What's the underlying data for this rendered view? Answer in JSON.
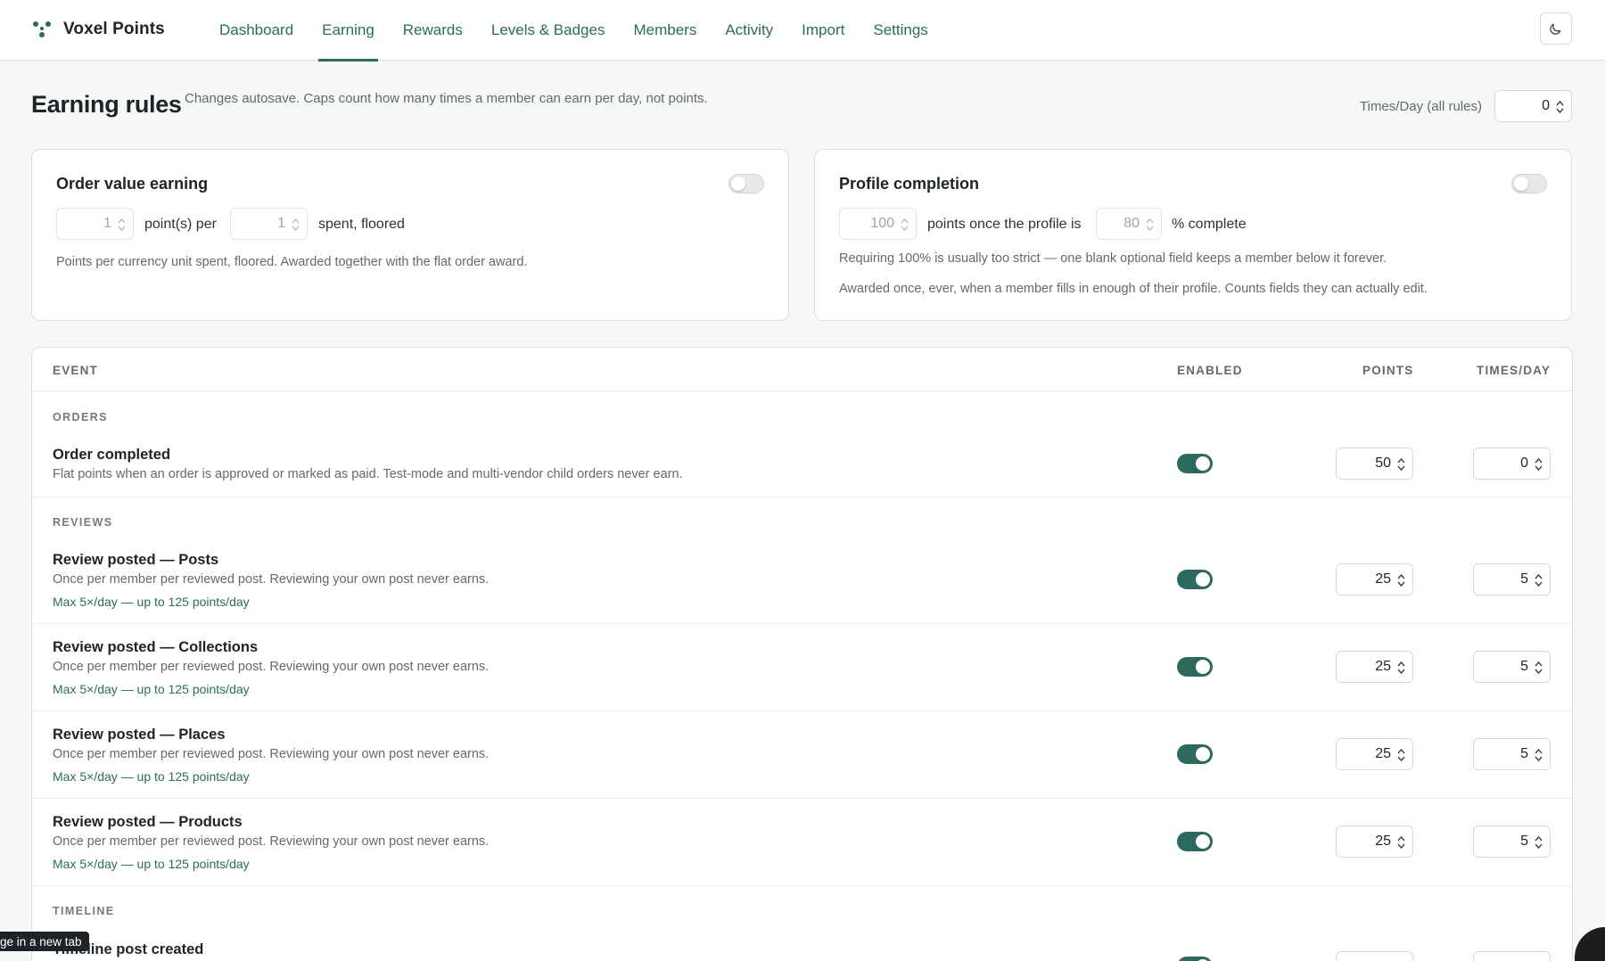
{
  "app": {
    "name": "Voxel Points",
    "logo_icon": "molecule-logo-icon",
    "accent_color": "#2d6a5d"
  },
  "nav": {
    "items": [
      {
        "label": "Dashboard",
        "active": false
      },
      {
        "label": "Earning",
        "active": true
      },
      {
        "label": "Rewards",
        "active": false
      },
      {
        "label": "Levels & Badges",
        "active": false
      },
      {
        "label": "Members",
        "active": false
      },
      {
        "label": "Activity",
        "active": false
      },
      {
        "label": "Import",
        "active": false
      },
      {
        "label": "Settings",
        "active": false
      }
    ],
    "theme_toggle_icon": "moon-icon"
  },
  "header": {
    "title": "Earning rules",
    "description": "Changes autosave. Caps count how many times a member can earn per day, not points.",
    "global_cap_label": "Times/Day (all rules)",
    "global_cap_value": "0"
  },
  "order_value_card": {
    "title": "Order value earning",
    "enabled": false,
    "points_value": "1",
    "points_label": "point(s) per",
    "spent_value": "1",
    "spent_label": "spent, floored",
    "help": "Points per currency unit spent, floored. Awarded together with the flat order award."
  },
  "profile_card": {
    "title": "Profile completion",
    "enabled": false,
    "points_value": "100",
    "points_label": "points once the profile is",
    "percent_value": "80",
    "percent_label": "% complete",
    "help_1": "Requiring 100% is usually too strict — one blank optional field keeps a member below it forever.",
    "help_2": "Awarded once, ever, when a member fills in enough of their profile. Counts fields they can actually edit."
  },
  "table": {
    "headers": {
      "event": "EVENT",
      "enabled": "ENABLED",
      "points": "POINTS",
      "times_day": "TIMES/DAY"
    },
    "groups": [
      {
        "label": "ORDERS",
        "rows": [
          {
            "title": "Order completed",
            "desc": "Flat points when an order is approved or marked as paid. Test-mode and multi-vendor child orders never earn.",
            "cap": "",
            "enabled": true,
            "points": "50",
            "times_day": "0"
          }
        ]
      },
      {
        "label": "REVIEWS",
        "rows": [
          {
            "title": "Review posted — Posts",
            "desc": "Once per member per reviewed post. Reviewing your own post never earns.",
            "cap": "Max 5×/day — up to 125 points/day",
            "enabled": true,
            "points": "25",
            "times_day": "5"
          },
          {
            "title": "Review posted — Collections",
            "desc": "Once per member per reviewed post. Reviewing your own post never earns.",
            "cap": "Max 5×/day — up to 125 points/day",
            "enabled": true,
            "points": "25",
            "times_day": "5"
          },
          {
            "title": "Review posted — Places",
            "desc": "Once per member per reviewed post. Reviewing your own post never earns.",
            "cap": "Max 5×/day — up to 125 points/day",
            "enabled": true,
            "points": "25",
            "times_day": "5"
          },
          {
            "title": "Review posted — Products",
            "desc": "Once per member per reviewed post. Reviewing your own post never earns.",
            "cap": "Max 5×/day — up to 125 points/day",
            "enabled": true,
            "points": "25",
            "times_day": "5"
          }
        ]
      },
      {
        "label": "TIMELINE",
        "rows": [
          {
            "title": "Timeline post created",
            "desc": "",
            "cap": "",
            "enabled": true,
            "points": "",
            "times_day": ""
          }
        ]
      }
    ]
  },
  "tooltip": {
    "text": "ge in a new tab"
  }
}
